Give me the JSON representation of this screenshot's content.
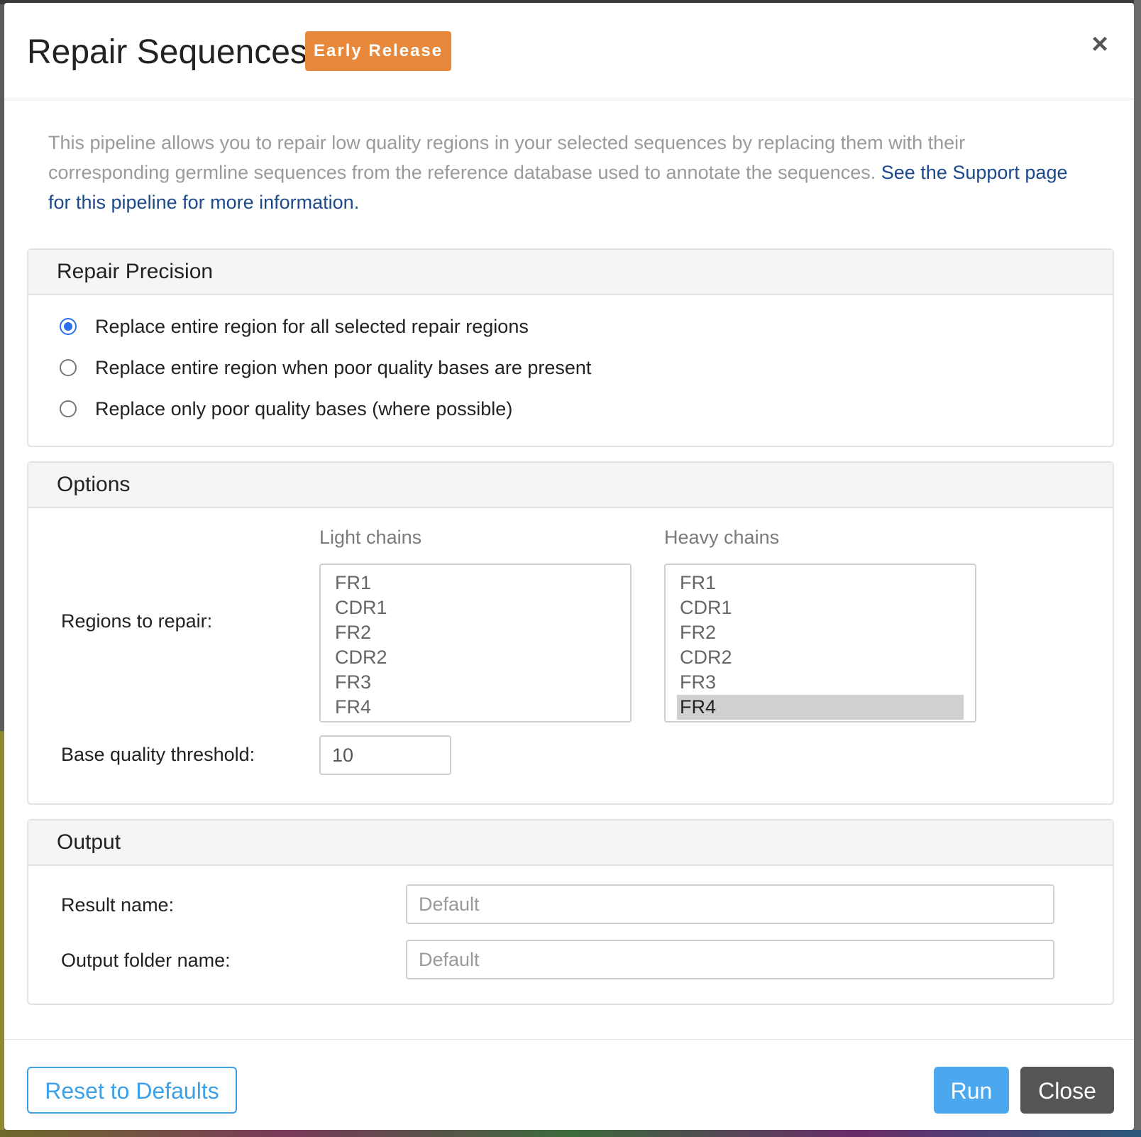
{
  "dialog": {
    "title": "Repair Sequences",
    "badge": "Early Release",
    "close_icon": "×",
    "intro_text": "This pipeline allows you to repair low quality regions in your selected sequences by replacing them with their corresponding germline sequences from the reference database used to annotate the sequences. ",
    "intro_link": "See the Support page for this pipeline for more information."
  },
  "repair_precision": {
    "heading": "Repair Precision",
    "options": [
      {
        "label": "Replace entire region for all selected repair regions",
        "checked": true
      },
      {
        "label": "Replace entire region when poor quality bases are present",
        "checked": false
      },
      {
        "label": "Replace only poor quality bases (where possible)",
        "checked": false
      }
    ]
  },
  "options": {
    "heading": "Options",
    "regions_label": "Regions to repair:",
    "light_chains": {
      "header": "Light chains",
      "items": [
        "FR1",
        "CDR1",
        "FR2",
        "CDR2",
        "FR3",
        "FR4"
      ],
      "selected": []
    },
    "heavy_chains": {
      "header": "Heavy chains",
      "items": [
        "FR1",
        "CDR1",
        "FR2",
        "CDR2",
        "FR3",
        "FR4"
      ],
      "selected": [
        "FR4"
      ]
    },
    "threshold_label": "Base quality threshold:",
    "threshold_value": "10"
  },
  "output": {
    "heading": "Output",
    "result_name_label": "Result name:",
    "result_name_placeholder": "Default",
    "result_name_value": "",
    "folder_name_label": "Output folder name:",
    "folder_name_placeholder": "Default",
    "folder_name_value": ""
  },
  "footer": {
    "reset_label": "Reset to Defaults",
    "run_label": "Run",
    "close_label": "Close"
  },
  "colors": {
    "badge": "#e8883a",
    "primary": "#4ba8ee",
    "link": "#1c4a8a",
    "radio_checked": "#2a6ff0",
    "close_button": "#555555"
  }
}
